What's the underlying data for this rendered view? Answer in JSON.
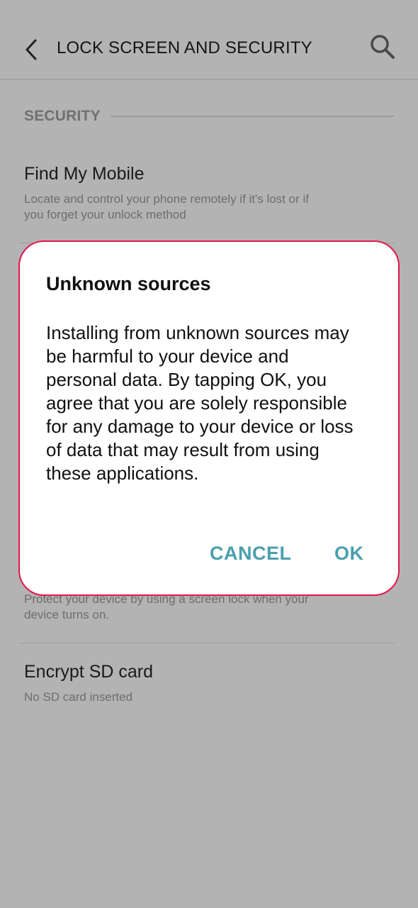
{
  "app_bar": {
    "title": "LOCK SCREEN AND SECURITY",
    "back_icon": "chevron-left-icon",
    "search_icon": "search-icon"
  },
  "section": {
    "label": "SECURITY"
  },
  "settings": {
    "find_my_mobile": {
      "title": "Find My Mobile",
      "description": "Locate and control your phone remotely if it's lost or if you forget your unlock method"
    },
    "secure_startup": {
      "description": "Protect your device by using a screen lock when your device turns on."
    },
    "encrypt_sd": {
      "title": "Encrypt SD card",
      "description": "No SD card inserted"
    }
  },
  "dialog": {
    "title": "Unknown sources",
    "message": "Installing from unknown sources may be harmful to your device and personal data. By tapping OK, you agree that you are solely responsible for any damage to your device or loss of data that may result from using these applications.",
    "cancel_label": "CANCEL",
    "ok_label": "OK"
  },
  "colors": {
    "scrim_background": "#b3b3b3",
    "dialog_border": "#e2164f",
    "dialog_button": "#4a9fae"
  }
}
